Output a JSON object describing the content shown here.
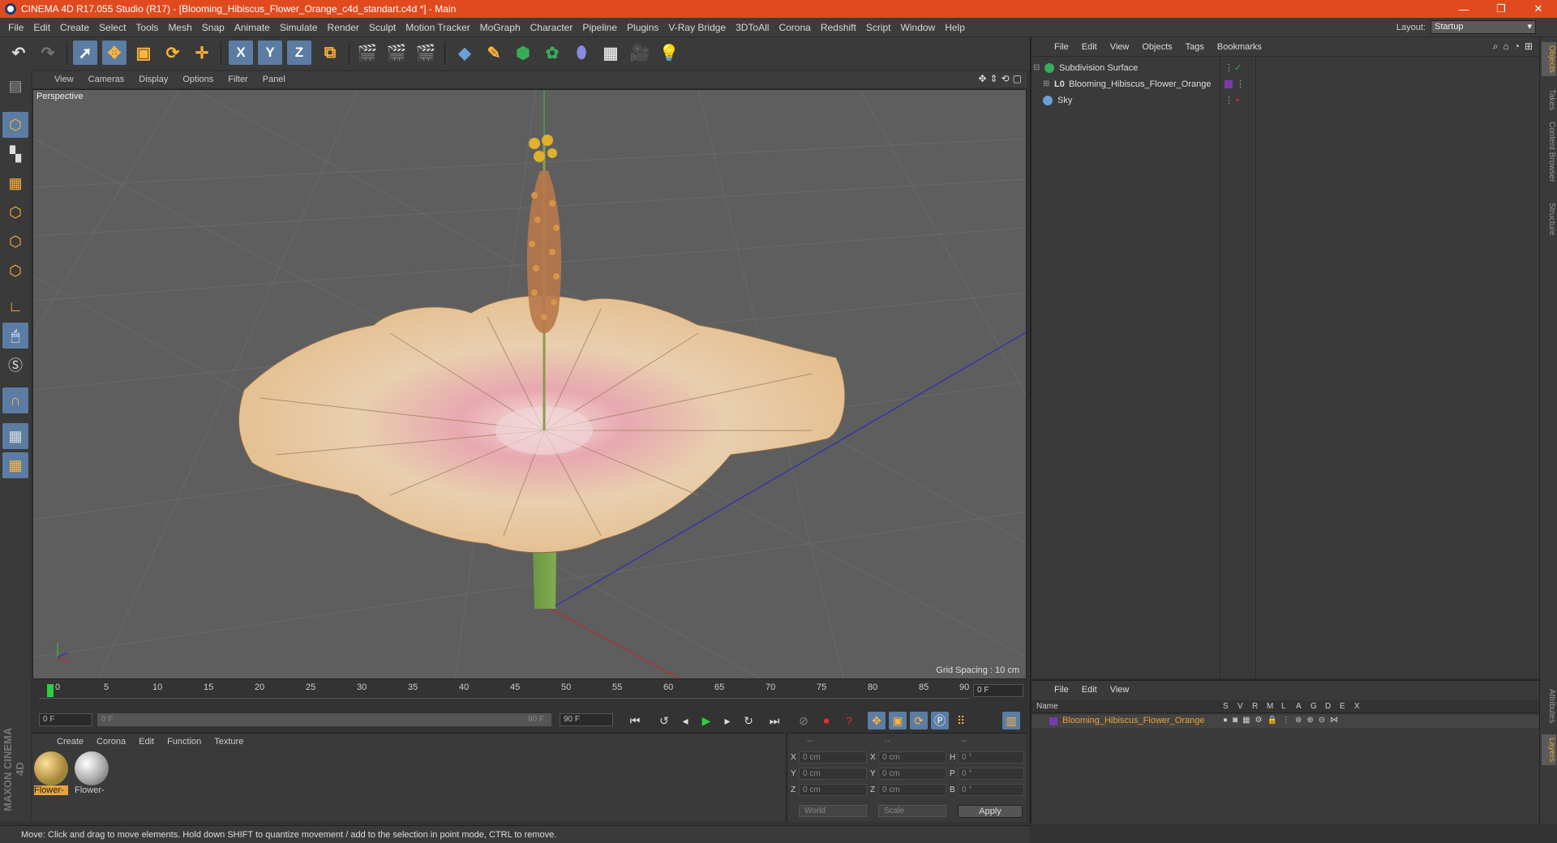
{
  "app": {
    "title": "CINEMA 4D R17.055 Studio (R17) - [Blooming_Hibiscus_Flower_Orange_c4d_standart.c4d *] - Main"
  },
  "window_controls": {
    "minimize": "—",
    "restore": "❐",
    "close": "✕"
  },
  "menubar": {
    "items": [
      "File",
      "Edit",
      "Create",
      "Select",
      "Tools",
      "Mesh",
      "Snap",
      "Animate",
      "Simulate",
      "Render",
      "Sculpt",
      "Motion Tracker",
      "MoGraph",
      "Character",
      "Pipeline",
      "Plugins",
      "V-Ray Bridge",
      "3DToAll",
      "Corona",
      "Redshift",
      "Script",
      "Window",
      "Help"
    ],
    "layout_label": "Layout:",
    "layout_value": "Startup"
  },
  "toolbar": {
    "axis_x": "X",
    "axis_y": "Y",
    "axis_z": "Z"
  },
  "viewport": {
    "menu": [
      "View",
      "Cameras",
      "Display",
      "Options",
      "Filter",
      "Panel"
    ],
    "camera_label": "Perspective",
    "grid_spacing": "Grid Spacing : 10 cm"
  },
  "timeline": {
    "ticks": [
      "0",
      "5",
      "10",
      "15",
      "20",
      "25",
      "30",
      "35",
      "40",
      "45",
      "50",
      "55",
      "60",
      "65",
      "70",
      "75",
      "80",
      "85",
      "90"
    ],
    "current_frame": "0 F",
    "start_frame": "0 F",
    "range_start": "0 F",
    "range_end": "90 F",
    "end_frame": "90 F"
  },
  "material_manager": {
    "menu": [
      "Create",
      "Corona",
      "Edit",
      "Function",
      "Texture"
    ],
    "materials": [
      {
        "label": "Flower-",
        "color": "#e8a23a"
      },
      {
        "label": "Flower-",
        "color": "#cccccc"
      }
    ]
  },
  "coordinates": {
    "header": [
      "--",
      "--",
      "--"
    ],
    "rows": [
      {
        "a": "X",
        "av": "0 cm",
        "b": "X",
        "bv": "0 cm",
        "c": "H",
        "cv": "0 °"
      },
      {
        "a": "Y",
        "av": "0 cm",
        "b": "Y",
        "bv": "0 cm",
        "c": "P",
        "cv": "0 °"
      },
      {
        "a": "Z",
        "av": "0 cm",
        "b": "Z",
        "bv": "0 cm",
        "c": "B",
        "cv": "0 °"
      }
    ],
    "world": "World",
    "scale": "Scale",
    "apply": "Apply"
  },
  "status": {
    "text": "Move: Click and drag to move elements. Hold down SHIFT to quantize movement / add to the selection in point mode, CTRL to remove."
  },
  "object_manager": {
    "menu": [
      "File",
      "Edit",
      "View",
      "Objects",
      "Tags",
      "Bookmarks"
    ],
    "objects": [
      {
        "name": "Subdivision Surface",
        "icon_color": "#3aaa5a"
      },
      {
        "name": "Blooming_Hibiscus_Flower_Orange",
        "icon_color": "#cccccc"
      },
      {
        "name": "Sky",
        "icon_color": "#6aa0d8"
      }
    ]
  },
  "right_tabs": [
    "Objects",
    "Takes",
    "Content Browser",
    "Structure",
    "Attributes",
    "Layers"
  ],
  "layer_manager": {
    "menu": [
      "File",
      "Edit",
      "View"
    ],
    "columns": [
      "Name",
      "S",
      "V",
      "R",
      "M",
      "L",
      "A",
      "G",
      "D",
      "E",
      "X"
    ],
    "layer_name": "Blooming_Hibiscus_Flower_Orange",
    "accent": "#e8a23a"
  },
  "logo": "MAXON CINEMA 4D"
}
